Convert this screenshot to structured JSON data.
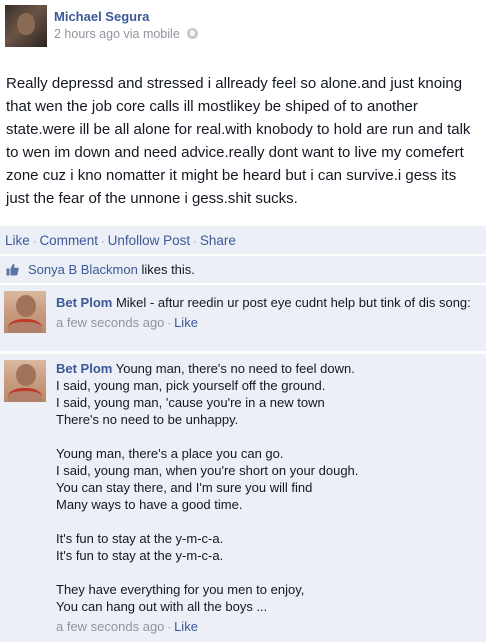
{
  "post": {
    "author": "Michael Segura",
    "time": "2 hours ago via mobile",
    "privacy_icon": "globe-icon",
    "text": "Really depressd and stressed i allready feel so alone.and just knoing that wen the job core calls ill mostlikey be shiped of to another state.were ill be all alone for real.with knobody to hold are run and talk to wen im down and need advice.really dont want to live my comefert zone cuz i kno nomatter it might be heard but i can survive.i gess its just the fear of the unnone i gess.shit sucks."
  },
  "actions": {
    "like": "Like",
    "comment": "Comment",
    "unfollow": "Unfollow Post",
    "share": "Share",
    "separator": "·"
  },
  "likes": {
    "icon": "thumbs-up-icon",
    "name": "Sonya B Blackmon",
    "suffix": " likes this."
  },
  "comments": [
    {
      "author": "Bet Plom",
      "text": "Mikel - aftur reedin ur post eye cudnt help but tink of dis song:",
      "time": "a few seconds ago",
      "like": "Like"
    },
    {
      "author": "Bet Plom",
      "lines": [
        "Young man, there's no need to feel down.",
        "I said, young man, pick yourself off the ground.",
        "I said, young man, 'cause you're in a new town",
        "There's no need to be unhappy.",
        "",
        "Young man, there's a place you can go.",
        "I said, young man, when you're short on your dough.",
        "You can stay there, and I'm sure you will find",
        "Many ways to have a good time.",
        "",
        "It's fun to stay at the y-m-c-a.",
        "It's fun to stay at the y-m-c-a.",
        "",
        "They have everything for you men to enjoy,",
        "You can hang out with all the boys ..."
      ],
      "time": "a few seconds ago",
      "like": "Like"
    }
  ]
}
